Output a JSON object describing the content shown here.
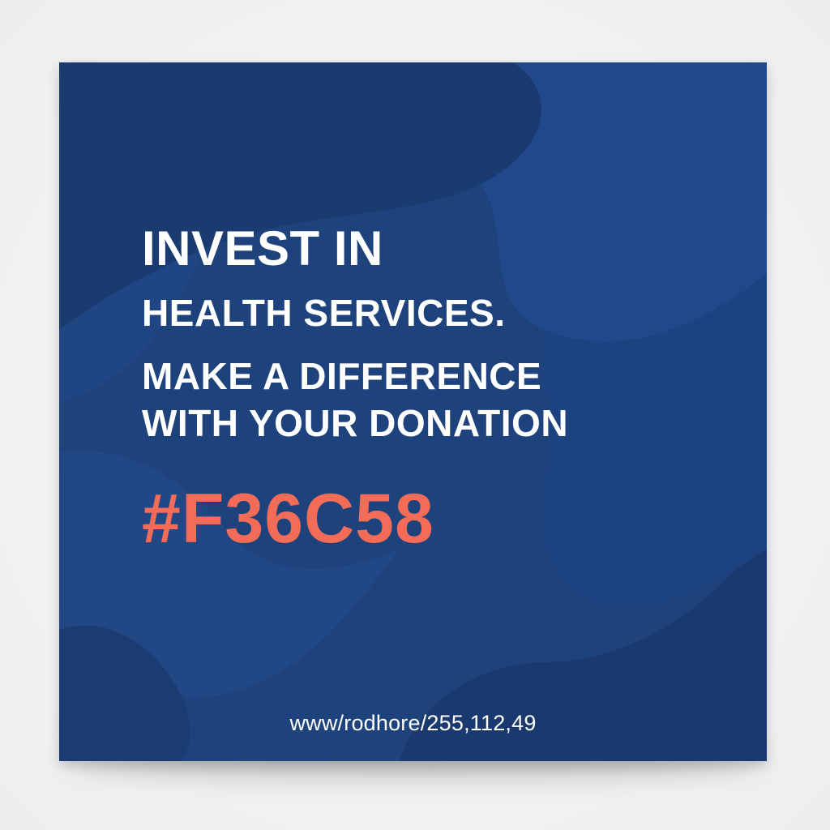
{
  "poster": {
    "line1": "INVEST IN",
    "line2": "HEALTH SERVICES.",
    "line3": "MAKE A DIFFERENCE",
    "line4": "WITH YOUR DONATION",
    "hex_code": "#F36C58",
    "url": "www/rodhore/255,112,49"
  },
  "colors": {
    "background_blue": "#1d427c",
    "accent_coral": "#f36c58",
    "text_white": "#ffffff",
    "page_gray": "#f1f2f4"
  }
}
